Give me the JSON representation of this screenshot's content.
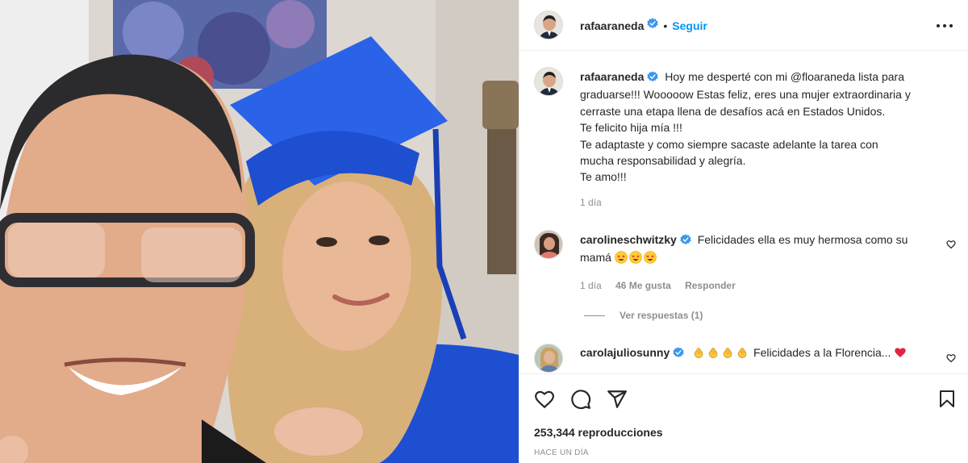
{
  "post": {
    "username": "rafaaraneda",
    "separator": "•",
    "follow_label": "Seguir",
    "more_icon": "more-options-icon"
  },
  "caption": {
    "username": "rafaaraneda",
    "lines": [
      "Hoy me desperté con mi @floaraneda lista para",
      "graduarse!!! Wooooow Estas feliz, eres una mujer extraordinaria y",
      "cerraste una etapa llena de desafíos acá en Estados Unidos.",
      "Te felicito hija mía !!!",
      "Te adaptaste y como siempre sacaste adelante la tarea con",
      "mucha responsabilidad y alegría.",
      "Te amo!!!"
    ],
    "time": "1 día"
  },
  "comments": [
    {
      "username": "carolineschwitzky",
      "text_line1": "Felicidades ella es muy hermosa como su",
      "text_line2": "mamá",
      "emojis": [
        "star-struck-emoji",
        "star-struck-emoji",
        "star-struck-emoji"
      ],
      "time": "1 día",
      "likes": "46 Me gusta",
      "reply_label": "Responder"
    },
    {
      "username": "carolajuliosunny",
      "emojis": [
        "clapping-hands-emoji",
        "clapping-hands-emoji",
        "clapping-hands-emoji",
        "clapping-hands-emoji"
      ],
      "text": "Felicidades a la Florencia...",
      "trailing_emoji": "red-heart-emoji"
    }
  ],
  "view_replies_label": "Ver respuestas (1)",
  "stats": {
    "views": "253,344 reproducciones",
    "posted": "Hace un día"
  },
  "colors": {
    "accent": "#0095f6",
    "text": "#262626",
    "muted": "#8e8e8e",
    "border": "#efefef",
    "verified": "#3897f0",
    "heart": "#ed4956"
  }
}
